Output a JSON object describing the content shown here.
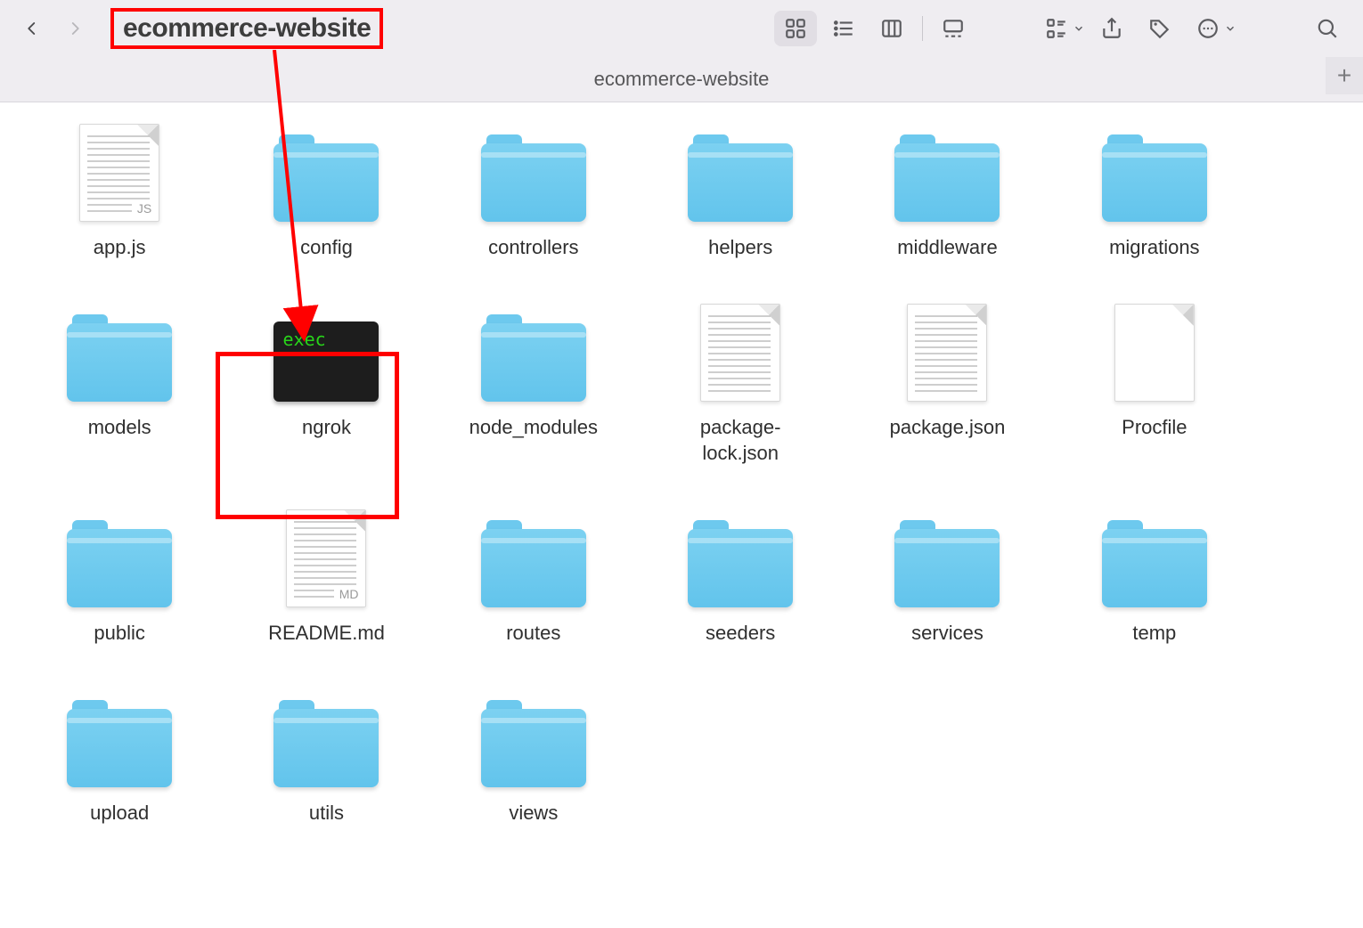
{
  "toolbar": {
    "title": "ecommerce-website",
    "icons": {
      "back": "chevron-left-icon",
      "forward": "chevron-right-icon",
      "view_icon": "grid-icon",
      "view_list": "list-icon",
      "view_columns": "columns-icon",
      "view_gallery": "gallery-icon",
      "group": "group-icon",
      "share": "share-icon",
      "tag": "tag-icon",
      "more": "more-icon",
      "search": "search-icon"
    }
  },
  "tabbar": {
    "active_tab": "ecommerce-website",
    "new_tab_glyph": "+"
  },
  "files": [
    {
      "name": "app.js",
      "type": "js"
    },
    {
      "name": "config",
      "type": "folder"
    },
    {
      "name": "controllers",
      "type": "folder"
    },
    {
      "name": "helpers",
      "type": "folder"
    },
    {
      "name": "middleware",
      "type": "folder"
    },
    {
      "name": "migrations",
      "type": "folder"
    },
    {
      "name": "models",
      "type": "folder"
    },
    {
      "name": "ngrok",
      "type": "exec"
    },
    {
      "name": "node_modules",
      "type": "folder"
    },
    {
      "name": "package-\nlock.json",
      "type": "text"
    },
    {
      "name": "package.json",
      "type": "text"
    },
    {
      "name": "Procfile",
      "type": "blank"
    },
    {
      "name": "public",
      "type": "folder"
    },
    {
      "name": "README.md",
      "type": "md"
    },
    {
      "name": "routes",
      "type": "folder"
    },
    {
      "name": "seeders",
      "type": "folder"
    },
    {
      "name": "services",
      "type": "folder"
    },
    {
      "name": "temp",
      "type": "folder"
    },
    {
      "name": "upload",
      "type": "folder"
    },
    {
      "name": "utils",
      "type": "folder"
    },
    {
      "name": "views",
      "type": "folder"
    }
  ],
  "badges": {
    "js": "JS",
    "md": "MD",
    "exec": "exec",
    "text": "",
    "blank": ""
  },
  "annotations": {
    "highlighted_title": true,
    "highlighted_item": "ngrok",
    "arrow_from": "title",
    "arrow_to": "ngrok"
  }
}
